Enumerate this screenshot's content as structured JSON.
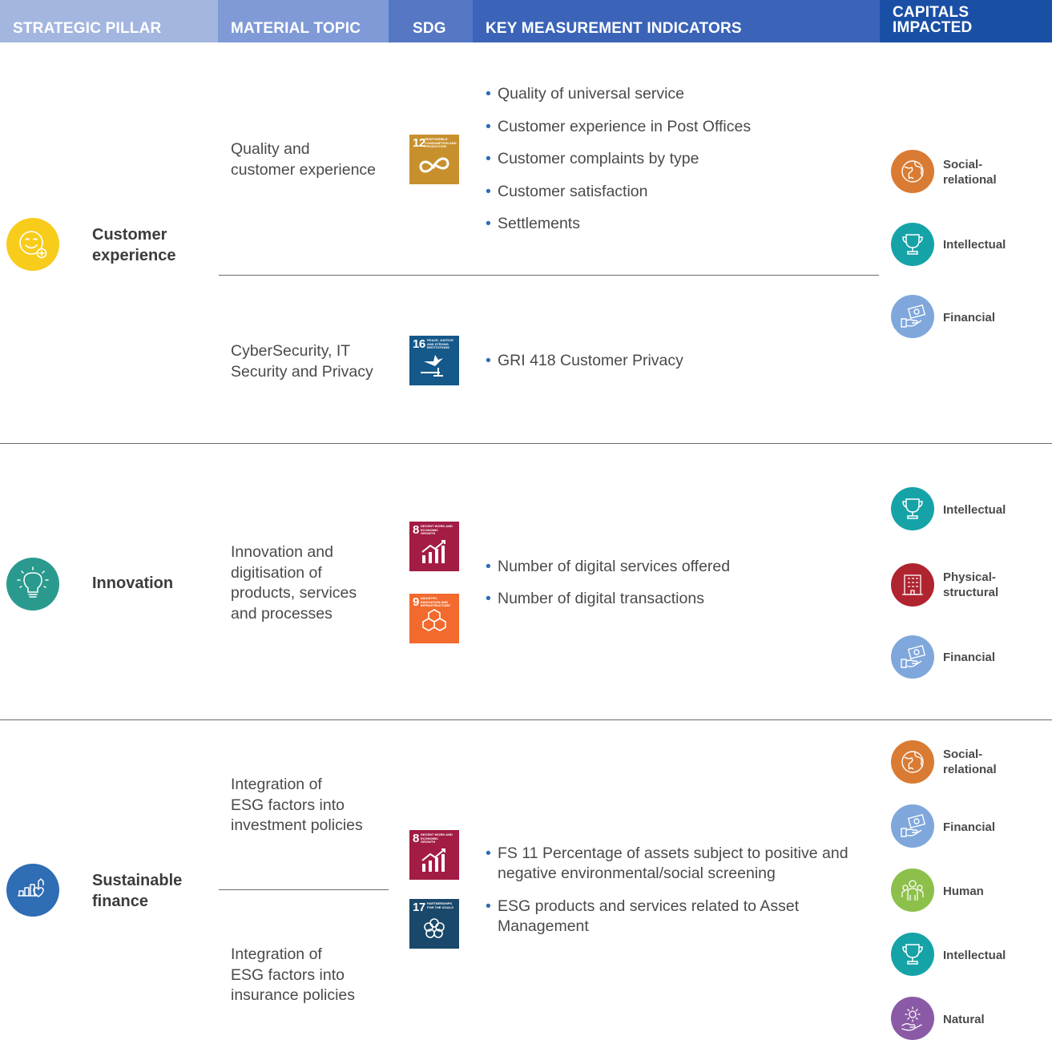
{
  "header": {
    "strategic_pillar": "STRATEGIC PILLAR",
    "material_topic": "MATERIAL TOPIC",
    "sdg": "SDG",
    "kmi": "KEY MEASUREMENT INDICATORS",
    "capitals_1": "CAPITALS",
    "capitals_2": "IMPACTED"
  },
  "colors": {
    "header_pillar": "#a3b6e0",
    "header_topic": "#7f9ad6",
    "header_sdg": "#5577c4",
    "header_kmi": "#3b64b8",
    "header_capitals": "#1a4fa6",
    "customer": "#f7cc1b",
    "innovation": "#2a9a8e",
    "sustainable": "#2f6db4",
    "social": "#d97b33",
    "intellectual": "#16a3a8",
    "financial": "#7fa7dc",
    "physical": "#b0242f",
    "human": "#8cc04b",
    "natural": "#8a5aa6"
  },
  "pillars": [
    {
      "name_1": "Customer",
      "name_2": "experience",
      "icon": "smiley-plus-icon",
      "topics": [
        {
          "line_1": "Quality and",
          "line_2": "customer experience"
        },
        {
          "line_1": "CyberSecurity, IT",
          "line_2": "Security and Privacy"
        }
      ],
      "sdgs": [
        {
          "num": "12",
          "label": "Responsible consumption and production",
          "color": "#c8902d",
          "icon": "infinity-icon"
        },
        {
          "num": "16",
          "label": "Peace, justice and strong institutions",
          "color": "#15588a",
          "icon": "dove-gavel-icon"
        }
      ],
      "indicators_a": [
        "Quality of universal service",
        "Customer experience in Post Offices",
        "Customer complaints by type",
        "Customer satisfaction",
        "Settlements"
      ],
      "indicators_b": [
        "GRI 418 Customer Privacy"
      ],
      "capitals": [
        {
          "label_1": "Social-",
          "label_2": "relational",
          "icon": "globe-icon"
        },
        {
          "label_1": "Intellectual",
          "icon": "trophy-icon"
        },
        {
          "label_1": "Financial",
          "icon": "hand-money-icon"
        }
      ]
    },
    {
      "name_1": "Innovation",
      "icon": "lightbulb-icon",
      "topic": [
        "Innovation and",
        "digitisation of",
        "products, services",
        "and processes"
      ],
      "sdgs": [
        {
          "num": "8",
          "label": "Decent work and economic growth",
          "color": "#a21c44",
          "icon": "growth-chart-icon"
        },
        {
          "num": "9",
          "label": "Industry, innovation and infrastructure",
          "color": "#f26a2d",
          "icon": "cubes-icon"
        }
      ],
      "indicators": [
        "Number of digital services offered",
        "Number of digital transactions"
      ],
      "capitals": [
        {
          "label_1": "Intellectual",
          "icon": "trophy-icon"
        },
        {
          "label_1": "Physical-",
          "label_2": "structural",
          "icon": "building-icon"
        },
        {
          "label_1": "Financial",
          "icon": "hand-money-icon"
        }
      ]
    },
    {
      "name_1": "Sustainable",
      "name_2": "finance",
      "icon": "chart-heart-icon",
      "topics": [
        {
          "line_1": "Integration of",
          "line_2": "ESG factors into",
          "line_3": "investment policies"
        },
        {
          "line_1": "Integration of",
          "line_2": "ESG factors into",
          "line_3": "insurance policies"
        }
      ],
      "sdgs": [
        {
          "num": "8",
          "label": "Decent work and economic growth",
          "color": "#a21c44",
          "icon": "growth-chart-icon"
        },
        {
          "num": "17",
          "label": "Partnerships for the goals",
          "color": "#19486a",
          "icon": "flower-rings-icon"
        }
      ],
      "indicators": [
        {
          "line_1": "FS 11 Percentage of assets subject to positive and",
          "line_2": "negative environmental/social screening"
        },
        {
          "line_1": "ESG products and services related to Asset",
          "line_2": "Management"
        }
      ],
      "capitals": [
        {
          "label_1": "Social-",
          "label_2": "relational",
          "icon": "globe-icon"
        },
        {
          "label_1": "Financial",
          "icon": "hand-money-icon"
        },
        {
          "label_1": "Human",
          "icon": "people-icon"
        },
        {
          "label_1": "Intellectual",
          "icon": "trophy-icon"
        },
        {
          "label_1": "Natural",
          "icon": "sun-hand-icon"
        }
      ]
    }
  ]
}
